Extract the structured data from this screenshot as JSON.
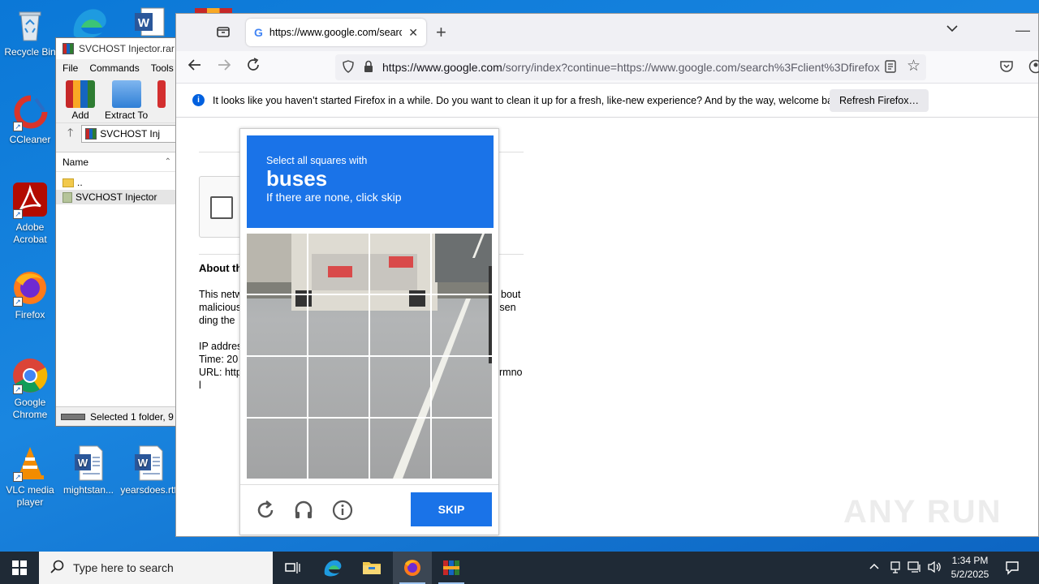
{
  "desktop": {
    "icons": [
      {
        "label": "Recycle Bin",
        "icon": "recycle-bin-icon"
      },
      {
        "label": "CCleaner",
        "icon": "ccleaner-icon"
      },
      {
        "label": "Adobe Acrobat",
        "icon": "acrobat-icon"
      },
      {
        "label": "Firefox",
        "icon": "firefox-icon"
      },
      {
        "label": "Google Chrome",
        "icon": "chrome-icon"
      },
      {
        "label": "VLC media player",
        "icon": "vlc-icon"
      },
      {
        "label": "mightstan...",
        "icon": "word-doc-icon"
      },
      {
        "label": "yearsdoes.rtf",
        "icon": "word-doc-icon"
      }
    ]
  },
  "winrar": {
    "title": "SVCHOST Injector.rar",
    "menu": [
      "File",
      "Commands",
      "Tools"
    ],
    "tools": [
      "Add",
      "Extract To"
    ],
    "path": "SVCHOST Inj",
    "column": "Name",
    "rows": [
      "..",
      "SVCHOST Injector"
    ],
    "status": "Selected 1 folder, 9"
  },
  "browser": {
    "tab_title": "https://www.google.com/search",
    "url_domain": "https://www.google.com",
    "url_rest": "/sorry/index?continue=https://www.google.com/search%3Fclient%3Dfirefox",
    "info_message": "It looks like you haven’t started Firefox in a while. Do you want to clean it up for a fresh, like-new experience? And by the way, welcome back!",
    "refresh_button": "Refresh Firefox…"
  },
  "sorry_page": {
    "about_heading": "About th",
    "para_left": [
      "This netw",
      "malicious",
      "ding the"
    ],
    "para_right": [
      "bout",
      "n sen",
      ""
    ],
    "ip_lines": [
      "IP addres",
      "Time: 20",
      "URL: http",
      "l"
    ],
    "url_tail": "rmno"
  },
  "captcha": {
    "instruction": "Select all squares with",
    "target": "buses",
    "hint": "If there are none, click skip",
    "skip_label": "SKIP"
  },
  "taskbar": {
    "search_placeholder": "Type here to search",
    "time": "1:34 PM",
    "date": "5/2/2025"
  },
  "watermark": "ANY RUN"
}
